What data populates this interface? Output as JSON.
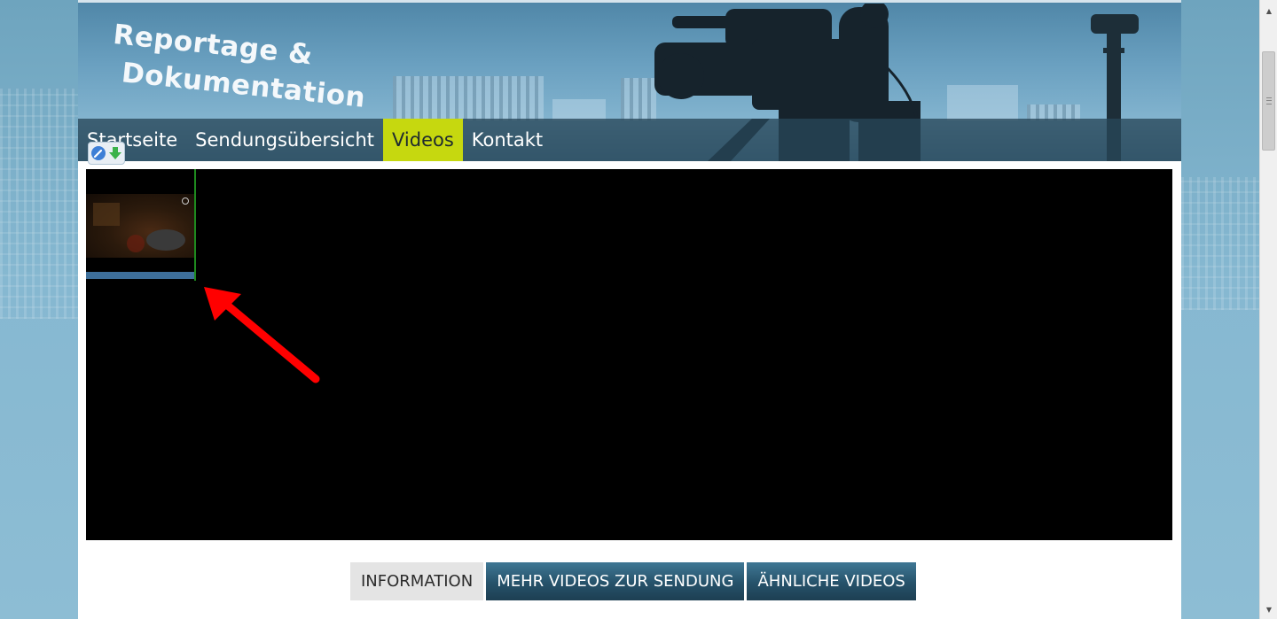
{
  "site": {
    "logo_line1": "Reportage &",
    "logo_line2": "Dokumentation"
  },
  "nav": {
    "items": [
      {
        "label": "Startseite",
        "active": false
      },
      {
        "label": "Sendungsübersicht",
        "active": false
      },
      {
        "label": "Videos",
        "active": true
      },
      {
        "label": "Kontakt",
        "active": false
      }
    ]
  },
  "tabs": [
    {
      "label": "INFORMATION",
      "selected": true
    },
    {
      "label": "MEHR VIDEOS ZUR SENDUNG",
      "selected": false
    },
    {
      "label": "ÄHNLICHE VIDEOS",
      "selected": false
    }
  ],
  "colors": {
    "nav_active": "#c6d80f",
    "annotation_arrow": "#ff0000",
    "tab_dark": "#26526a",
    "thumb_bar": "#3e6f9a"
  },
  "icons": {
    "addon": "pencil-download-icon",
    "scroll_up": "scroll-up-arrow-icon",
    "scroll_down": "scroll-down-arrow-icon"
  }
}
